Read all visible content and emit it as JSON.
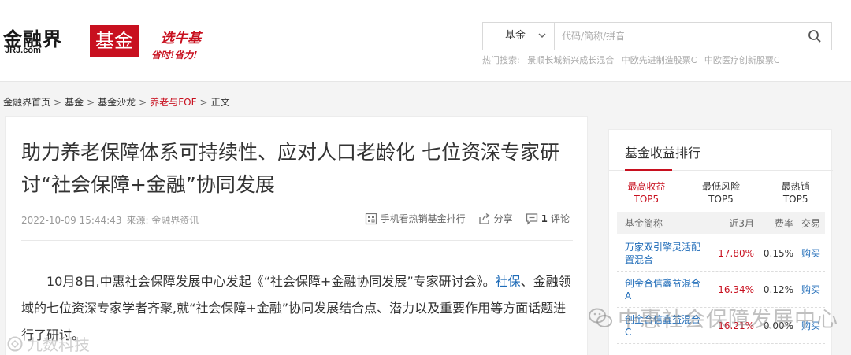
{
  "header": {
    "logo_text": "金融界",
    "logo_domain": "JRJ.com",
    "section_logo": "基金",
    "slogan_line1": "选牛基",
    "slogan_line2": "省时!省力!",
    "search": {
      "category": "基金",
      "placeholder": "代码/简称/拼音"
    },
    "hot_label": "热门搜索:",
    "hot_items": [
      "景顺长城新兴成长混合",
      "中欧先进制造股票C",
      "中欧医疗创新股票C"
    ]
  },
  "breadcrumb": [
    "金融界首页",
    "基金",
    "基金沙龙",
    "养老与FOF",
    "正文"
  ],
  "article": {
    "title": "助力养老保障体系可持续性、应对人口老龄化 七位资深专家研讨“社会保障+金融”协同发展",
    "date": "2022-10-09 15:44:43",
    "source": "来源: 金融界资讯",
    "tool_mobile": "手机看热销基金排行",
    "tool_share": "分享",
    "comment_count": "1",
    "comment_label": "评论",
    "body_part1": "10月8日,中惠社会保障发展中心发起《“社会保障+金融协同发展”专家研讨会》。",
    "body_link": "社保",
    "body_part2": "、金融领域的七位资深专家学者齐聚,就“社会保障+金融”协同发展结合点、潜力以及重要作用等方面话题进行了研讨。"
  },
  "sidebar": {
    "title": "基金收益排行",
    "tabs": [
      {
        "line1": "最高收益",
        "line2": "TOP5"
      },
      {
        "line1": "最低风险",
        "line2": "TOP5"
      },
      {
        "line1": "最热销",
        "line2": "TOP5"
      }
    ],
    "columns": [
      "基金简称",
      "近3月",
      "费率",
      "交易"
    ],
    "rows": [
      {
        "name": "万家双引擎灵活配置混合",
        "return": "17.80%",
        "fee": "0.15%",
        "action": "购买"
      },
      {
        "name": "创金合信鑫益混合A",
        "return": "16.34%",
        "fee": "0.12%",
        "action": "购买"
      },
      {
        "name": "创金合信鑫益混合C",
        "return": "16.21%",
        "fee": "0.00%",
        "action": "购买"
      }
    ]
  },
  "watermark": {
    "main": "中惠社会保障发展中心",
    "corner": "九数科技"
  },
  "colors": {
    "brand_red": "#c8101f",
    "link_blue": "#1e6bb8"
  }
}
